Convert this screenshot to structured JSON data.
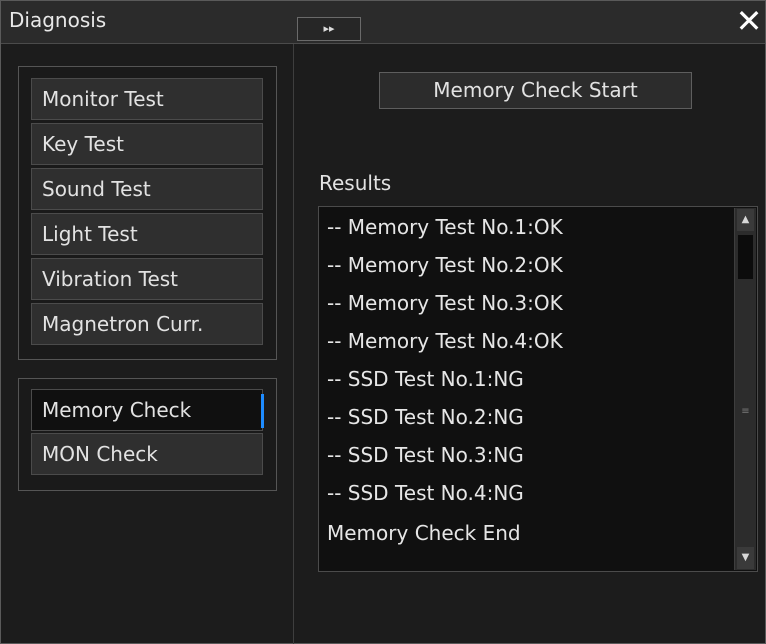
{
  "window": {
    "title": "Diagnosis",
    "collapse_glyph": "▸▸",
    "close_glyph": "✕"
  },
  "sidebar": {
    "group1": [
      {
        "label": "Monitor Test"
      },
      {
        "label": "Key Test"
      },
      {
        "label": "Sound Test"
      },
      {
        "label": "Light Test"
      },
      {
        "label": "Vibration Test"
      },
      {
        "label": "Magnetron Curr."
      }
    ],
    "group2": [
      {
        "label": "Memory Check",
        "selected": true
      },
      {
        "label": "MON Check",
        "selected": false
      }
    ]
  },
  "main": {
    "start_button": "Memory Check Start",
    "results_label": "Results",
    "results": [
      "-- Memory Test No.1:OK",
      "-- Memory Test No.2:OK",
      "-- Memory Test No.3:OK",
      "-- Memory Test No.4:OK",
      "-- SSD Test No.1:NG",
      "-- SSD Test No.2:NG",
      "-- SSD Test No.3:NG",
      "-- SSD Test No.4:NG",
      "Memory Check End"
    ]
  },
  "colors": {
    "accent": "#1e8cff",
    "background": "#1c1c1c"
  }
}
